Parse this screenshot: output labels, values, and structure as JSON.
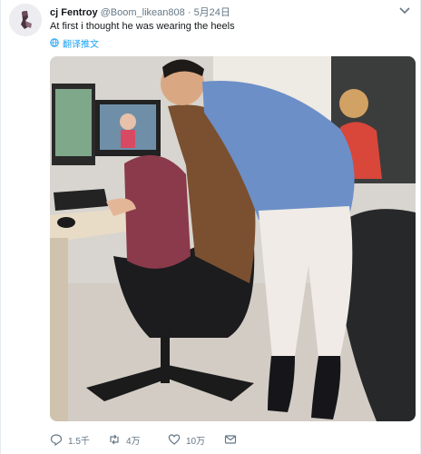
{
  "tweet": {
    "display_name": "cj Fentroy",
    "handle": "@Boom_likean808",
    "separator": "·",
    "date": "5月24日",
    "text": "At first i thought he was wearing the heels",
    "translate_label": "翻译推文"
  },
  "actions": {
    "reply_count": "1.5千",
    "retweet_count": "4万",
    "like_count": "10万"
  },
  "icons": {
    "avatar": "avatar",
    "menu": "chevron-down-icon",
    "translate": "globe-icon",
    "reply": "reply-icon",
    "retweet": "retweet-icon",
    "like": "heart-icon",
    "message": "envelope-icon"
  },
  "colors": {
    "link": "#1da1f2",
    "meta": "#657786",
    "text": "#14171a"
  }
}
